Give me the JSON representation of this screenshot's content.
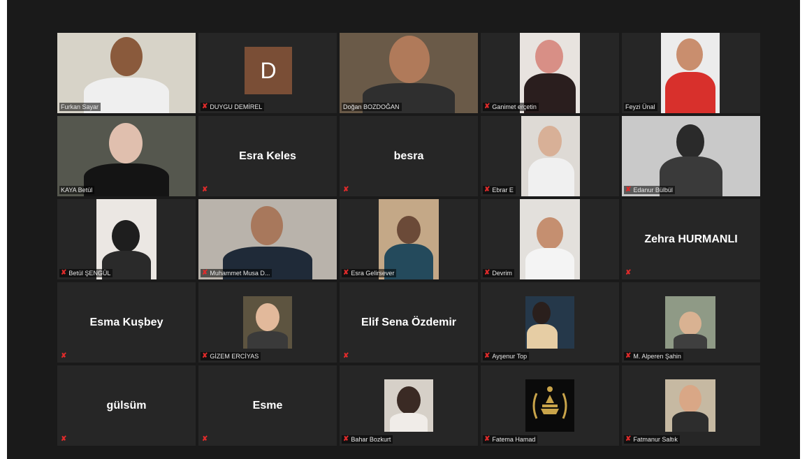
{
  "participants": [
    {
      "name": "Furkan Sayar",
      "muted": false
    },
    {
      "name": "DUYGU DEMİREL",
      "muted": true,
      "initial": "D"
    },
    {
      "name": "Doğan BOZDOĞAN",
      "muted": false
    },
    {
      "name": "Ganimet erçetin",
      "muted": true
    },
    {
      "name": "Feyzi Ünal",
      "muted": false
    },
    {
      "name": "KAYA Betül",
      "muted": false
    },
    {
      "name": "Esra Keles",
      "muted": true
    },
    {
      "name": "besra",
      "muted": true
    },
    {
      "name": "Ebrar E",
      "muted": true
    },
    {
      "name": "Edanur Bülbül",
      "muted": true
    },
    {
      "name": "Betül ŞENGÜL",
      "muted": true
    },
    {
      "name": "Muhammet Musa D...",
      "muted": true
    },
    {
      "name": "Esra Gelirsever",
      "muted": true
    },
    {
      "name": "Devrim",
      "muted": true
    },
    {
      "name": "Zehra HURMANLI",
      "muted": true
    },
    {
      "name": "Esma Kuşbey",
      "muted": true
    },
    {
      "name": "GİZEM ERCİYAS",
      "muted": true
    },
    {
      "name": "Elif Sena Özdemir",
      "muted": true
    },
    {
      "name": "Ayşenur Top",
      "muted": true
    },
    {
      "name": "M. Alperen Şahin",
      "muted": true
    },
    {
      "name": "gülsüm",
      "muted": true
    },
    {
      "name": "Esme",
      "muted": true
    },
    {
      "name": "Bahar Bozkurt",
      "muted": true
    },
    {
      "name": "Fatema Hamad",
      "muted": true
    },
    {
      "name": "Fatmanur Saltık",
      "muted": true
    }
  ],
  "colors": {
    "active_speaker": "#b9d74a",
    "muted_icon": "#e02b2b",
    "tile_bg": "#262626",
    "stage_bg": "#1a1a1a"
  },
  "icons": {
    "muted": "mic-muted-icon"
  }
}
